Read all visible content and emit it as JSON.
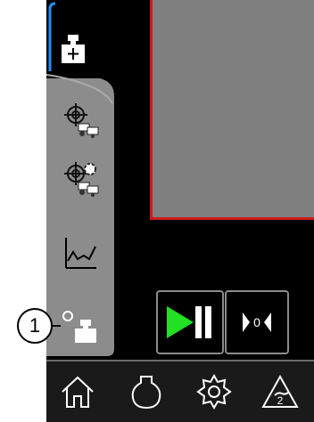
{
  "tabs": [
    {
      "icon": "weight-add-icon",
      "selected": true
    },
    {
      "icon": "target-wheels-icon",
      "selected": false
    },
    {
      "icon": "target-wheels-gear-icon",
      "selected": false
    },
    {
      "icon": "line-graph-icon",
      "selected": false
    },
    {
      "icon": "weight-status-icon",
      "selected": false
    }
  ],
  "controls": {
    "play_pause_icon": "play-pause-icon",
    "step_count": "0"
  },
  "bottom_nav": [
    {
      "icon": "home-icon"
    },
    {
      "icon": "flask-icon"
    },
    {
      "icon": "settings-gear-icon"
    },
    {
      "icon": "triangle-2-icon",
      "label": "2"
    }
  ],
  "callout": {
    "label": "1"
  },
  "colors": {
    "background": "#000000",
    "tab_active_accent": "#1e90ff",
    "view_border": "#d01818",
    "play_green": "#22e022"
  }
}
